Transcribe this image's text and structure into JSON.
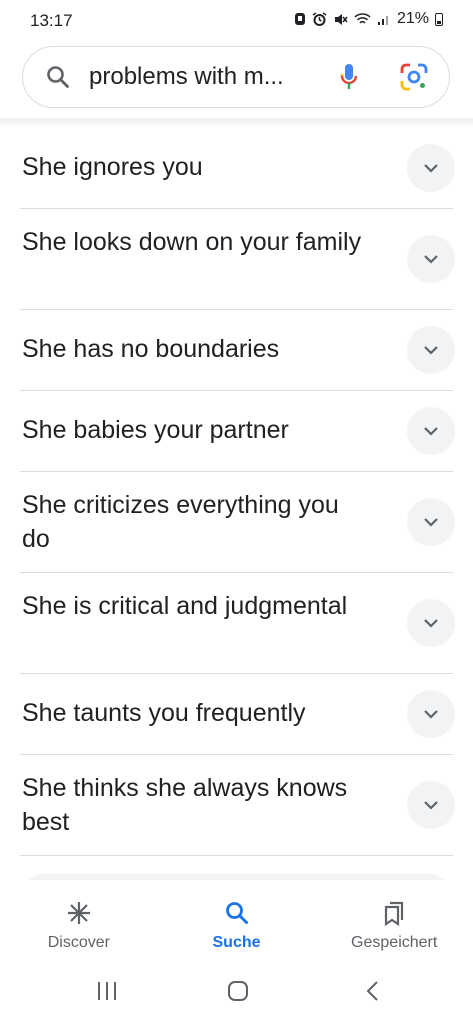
{
  "status_bar": {
    "time": "13:17",
    "battery": "21%"
  },
  "search": {
    "query": "problems with m..."
  },
  "faq": [
    {
      "text": "She ignores you"
    },
    {
      "text": "She looks down on your family"
    },
    {
      "text": "She has no boundaries"
    },
    {
      "text": "She babies your partner"
    },
    {
      "text": "She criticizes everything you do"
    },
    {
      "text": "She is critical and judgmental"
    },
    {
      "text": "She taunts you frequently"
    },
    {
      "text": "She thinks she always knows best"
    }
  ],
  "bottom_nav": [
    {
      "label": "Discover",
      "icon": "asterisk-icon",
      "active": false
    },
    {
      "label": "Suche",
      "icon": "search-icon",
      "active": true
    },
    {
      "label": "Gespeichert",
      "icon": "bookmarks-icon",
      "active": false
    }
  ],
  "colors": {
    "accent": "#1a73e8",
    "text": "#202124",
    "divider": "#dadce0"
  }
}
